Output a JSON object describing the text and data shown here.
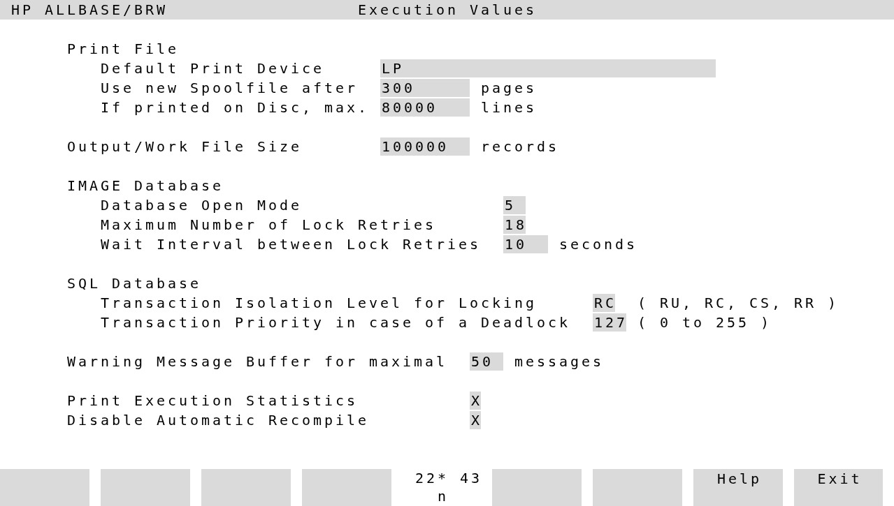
{
  "header": {
    "product": "HP ALLBASE/BRW",
    "title": "Execution Values"
  },
  "groups": [
    {
      "title": "Print File",
      "fields": [
        {
          "label": "Default Print Device",
          "value": "LP"
        },
        {
          "label": "Use new Spoolfile after",
          "value": "300",
          "unit": "pages"
        },
        {
          "label": "If printed on Disc, max.",
          "value": "80000",
          "unit": "lines"
        }
      ]
    },
    {
      "fields": [
        {
          "label": "Output/Work File Size",
          "value": "100000",
          "unit": "records"
        }
      ]
    },
    {
      "title": "IMAGE Database",
      "fields": [
        {
          "label": "Database Open Mode",
          "value": "5"
        },
        {
          "label": "Maximum Number of Lock Retries",
          "value": "18"
        },
        {
          "label": "Wait Interval between Lock Retries",
          "value": "10",
          "unit": "seconds"
        }
      ]
    },
    {
      "title": "SQL Database",
      "fields": [
        {
          "label": "Transaction Isolation Level for Locking",
          "value": "RC",
          "hint": "( RU, RC, CS, RR )"
        },
        {
          "label": "Transaction Priority in case of a Deadlock",
          "value": "127",
          "hint": "( 0 to 255 )"
        }
      ]
    },
    {
      "fields": [
        {
          "label": "Warning Message Buffer for maximal",
          "value": "50",
          "unit": "messages"
        }
      ]
    },
    {
      "fields": [
        {
          "label": "Print Execution Statistics",
          "value": "X"
        },
        {
          "label": "Disable Automatic Recompile",
          "value": "X"
        }
      ]
    }
  ],
  "softkeys_left": [
    {
      "kind": "blank"
    },
    {
      "kind": "blank"
    },
    {
      "kind": "blank"
    },
    {
      "kind": "blank"
    }
  ],
  "status": {
    "cursor": "22* 43",
    "mode": "n"
  },
  "softkeys_right": [
    {
      "kind": "blank"
    },
    {
      "kind": "blank"
    },
    {
      "kind": "labeled",
      "label": "Help"
    },
    {
      "kind": "labeled",
      "label": "Exit"
    }
  ]
}
